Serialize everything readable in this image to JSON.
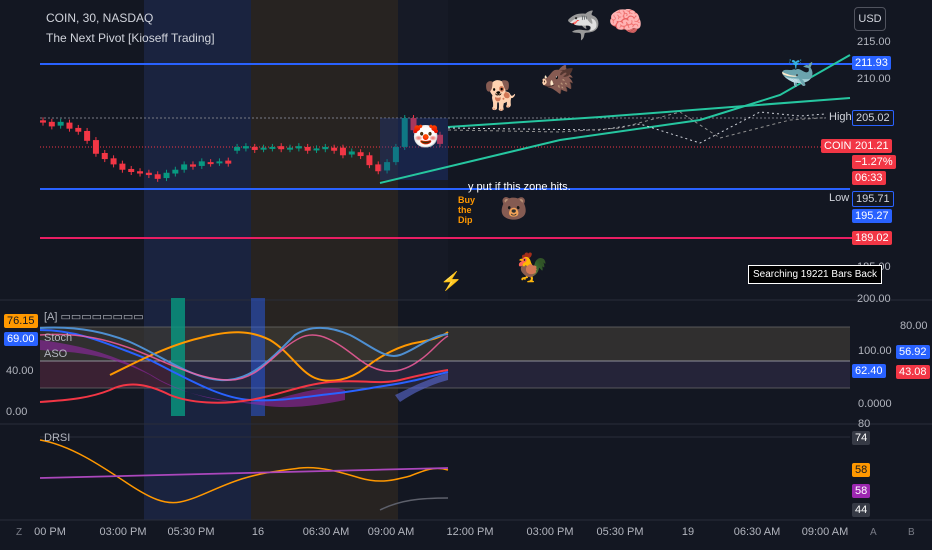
{
  "header": {
    "symbol_line": "COIN, 30, NASDAQ",
    "indicator": "The Next Pivot [Kioseff Trading]",
    "currency_button": "USD"
  },
  "price_axis": {
    "ticks": [
      "215.00",
      "210.00",
      "185.00",
      "200.00"
    ]
  },
  "price_tags": {
    "top_line": "211.93",
    "high_label": "High",
    "high": "205.02",
    "coin_label": "COIN",
    "coin_price": "201.21",
    "coin_change": "−1.27%",
    "coin_timer": "06:33",
    "low_label": "Low",
    "low": "195.71",
    "level2": "195.27",
    "level3": "189.02"
  },
  "annotations": {
    "zone_text": "y put if this zone hits.",
    "search_text": "Searching 19221 Bars Back",
    "dip_text": "Buy the Dip"
  },
  "emojis": {
    "shark": "🦈",
    "brain": "🧠",
    "boar": "🐗",
    "whale": "🐳",
    "dog": "🐕",
    "bear": "🐻",
    "chicken": "🐓",
    "bolt": "⚡",
    "clown": "🤡"
  },
  "osc": {
    "name": "[A]  ▭▭▭▭▭▭▭▭",
    "stoch": "Stoch",
    "aso": "ASO",
    "left_tags": [
      "76.15",
      "69.00"
    ],
    "left_ticks": [
      "40.00",
      "0.00"
    ],
    "right_ticks": [
      "80.00",
      "100.00",
      "0.0000"
    ],
    "right_tags": [
      "56.92",
      "62.40",
      "43.08"
    ]
  },
  "drsi": {
    "name": "DRSI",
    "right_ticks": [
      "80"
    ],
    "right_tags": [
      "74",
      "58",
      "58",
      "44"
    ]
  },
  "x_axis": {
    "labels": [
      "00 PM",
      "03:00 PM",
      "05:30 PM",
      "16",
      "06:30 AM",
      "09:00 AM",
      "12:00 PM",
      "03:00 PM",
      "05:30 PM",
      "19",
      "06:30 AM",
      "09:00 AM"
    ]
  },
  "corner_icons": {
    "left": "Z",
    "mid": "A",
    "right": "B"
  },
  "colors": {
    "bg": "#131722",
    "blue": "#2962ff",
    "red": "#f23645",
    "green": "#089981",
    "teal": "#26c6a0",
    "orange": "#ff9800",
    "pink": "#e91e63",
    "purple": "#9c27b0"
  },
  "chart_data": {
    "type": "candlestick",
    "ylim": [
      185,
      215
    ],
    "levels": [
      211.93,
      205.02,
      195.71,
      195.27,
      189.02
    ],
    "last_price": 201.21,
    "candles": [
      {
        "o": 204.3,
        "c": 204.0
      },
      {
        "o": 204.1,
        "c": 203.5
      },
      {
        "o": 203.6,
        "c": 204.1
      },
      {
        "o": 204.0,
        "c": 203.2
      },
      {
        "o": 203.3,
        "c": 202.8
      },
      {
        "o": 202.9,
        "c": 201.6
      },
      {
        "o": 201.7,
        "c": 199.9
      },
      {
        "o": 200.0,
        "c": 199.2
      },
      {
        "o": 199.3,
        "c": 198.5
      },
      {
        "o": 198.6,
        "c": 197.8
      },
      {
        "o": 197.9,
        "c": 197.5
      },
      {
        "o": 197.6,
        "c": 197.3
      },
      {
        "o": 197.4,
        "c": 197.1
      },
      {
        "o": 197.2,
        "c": 196.6
      },
      {
        "o": 196.7,
        "c": 197.4
      },
      {
        "o": 197.3,
        "c": 197.8
      },
      {
        "o": 197.8,
        "c": 198.5
      },
      {
        "o": 198.5,
        "c": 198.2
      },
      {
        "o": 198.3,
        "c": 198.9
      },
      {
        "o": 198.8,
        "c": 198.6
      },
      {
        "o": 198.7,
        "c": 198.9
      },
      {
        "o": 199.0,
        "c": 198.6
      },
      {
        "o": 200.3,
        "c": 200.8
      },
      {
        "o": 200.6,
        "c": 200.9
      },
      {
        "o": 200.8,
        "c": 200.4
      },
      {
        "o": 200.5,
        "c": 200.7
      },
      {
        "o": 200.6,
        "c": 200.8
      },
      {
        "o": 200.9,
        "c": 200.5
      },
      {
        "o": 200.5,
        "c": 200.7
      },
      {
        "o": 200.6,
        "c": 200.9
      },
      {
        "o": 200.8,
        "c": 200.3
      },
      {
        "o": 200.4,
        "c": 200.6
      },
      {
        "o": 200.5,
        "c": 200.8
      },
      {
        "o": 200.7,
        "c": 200.3
      },
      {
        "o": 200.7,
        "c": 199.7
      },
      {
        "o": 199.8,
        "c": 200.2
      },
      {
        "o": 200.1,
        "c": 199.6
      },
      {
        "o": 199.7,
        "c": 198.4
      },
      {
        "o": 198.5,
        "c": 197.6
      },
      {
        "o": 197.7,
        "c": 198.8
      },
      {
        "o": 198.8,
        "c": 200.8
      },
      {
        "o": 200.8,
        "c": 204.6
      },
      {
        "o": 204.6,
        "c": 203.0
      },
      {
        "o": 203.1,
        "c": 201.1
      },
      {
        "o": 201.2,
        "c": 202.5
      },
      {
        "o": 202.4,
        "c": 201.2
      }
    ],
    "x_labels": [
      "00 PM",
      "03:00 PM",
      "05:30 PM",
      "16",
      "06:30 AM",
      "09:00 AM",
      "12:00 PM",
      "03:00 PM",
      "05:30 PM",
      "19",
      "06:30 AM",
      "09:00 AM"
    ]
  }
}
